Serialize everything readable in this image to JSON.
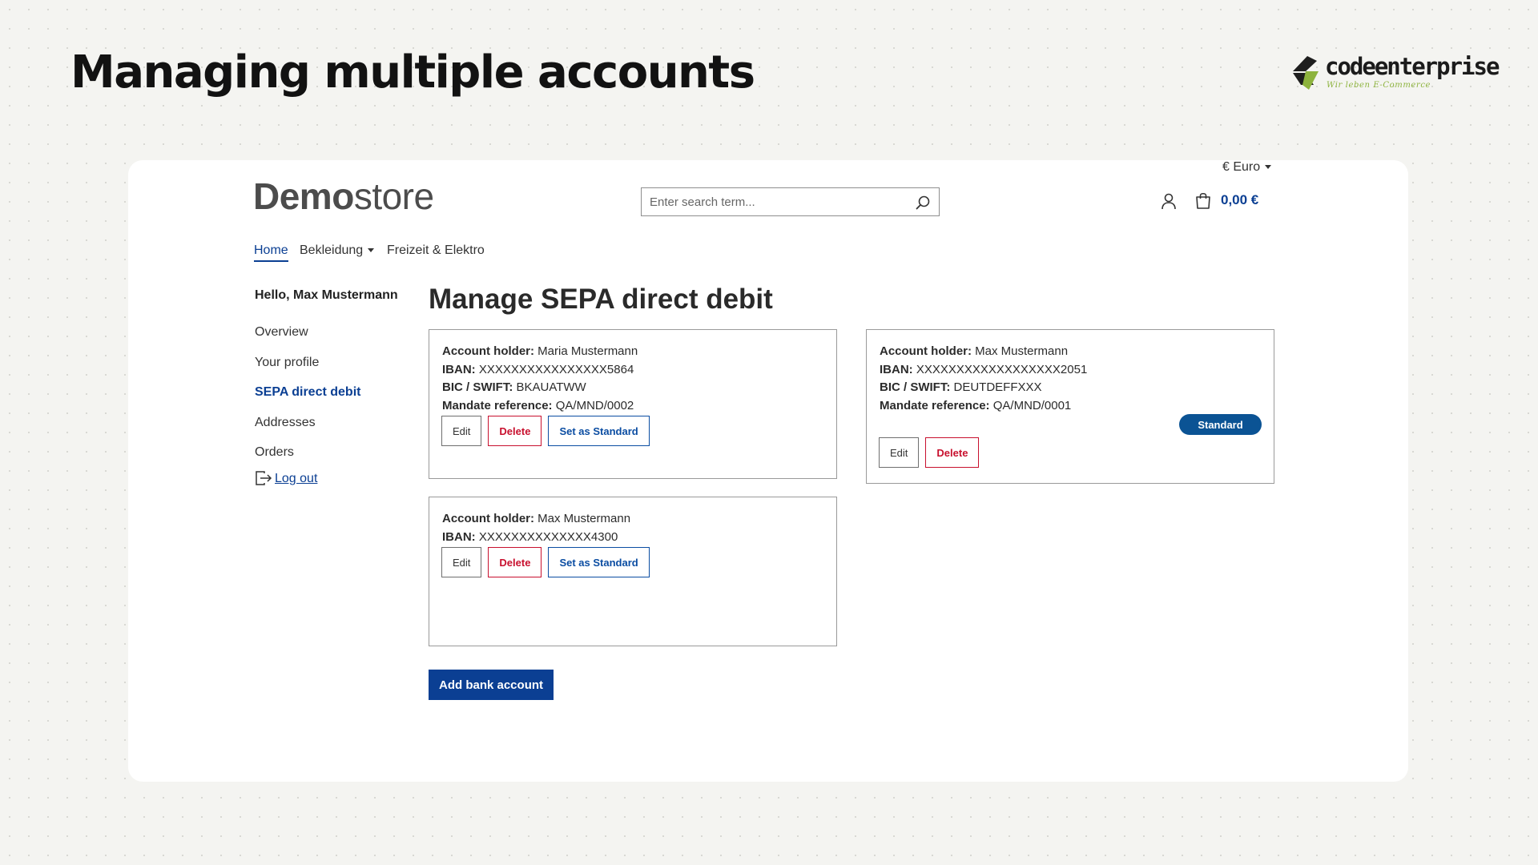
{
  "slide": {
    "title": "Managing multiple accounts",
    "logo": {
      "text": "codeenterprise",
      "tagline": "Wir leben E-Commerce"
    }
  },
  "store": {
    "brand": {
      "strong": "Demo",
      "light": "store"
    },
    "currency": "€ Euro",
    "search": {
      "placeholder": "Enter search term..."
    },
    "cart_total": "0,00 €",
    "nav": {
      "home": "Home",
      "bekleidung": "Bekleidung",
      "freizeit": "Freizeit & Elektro"
    }
  },
  "sidebar": {
    "greeting": "Hello, Max Mustermann",
    "items": [
      {
        "label": "Overview",
        "active": false
      },
      {
        "label": "Your profile",
        "active": false
      },
      {
        "label": "SEPA direct debit",
        "active": true
      },
      {
        "label": "Addresses",
        "active": false
      },
      {
        "label": "Orders",
        "active": false
      }
    ],
    "logout": "Log out"
  },
  "main": {
    "title": "Manage SEPA direct debit",
    "labels": {
      "holder": "Account holder:",
      "iban": "IBAN:",
      "bic": "BIC / SWIFT:",
      "mandate": "Mandate reference:"
    },
    "buttons": {
      "edit": "Edit",
      "delete": "Delete",
      "set_standard": "Set as Standard",
      "standard_badge": "Standard"
    },
    "accounts": [
      {
        "holder": "Maria Mustermann",
        "iban": "XXXXXXXXXXXXXXXX5864",
        "bic": "BKAUATWW",
        "mandate": "QA/MND/0002",
        "is_standard": false
      },
      {
        "holder": "Max Mustermann",
        "iban": "XXXXXXXXXXXXXXXXXX2051",
        "bic": "DEUTDEFFXXX",
        "mandate": "QA/MND/0001",
        "is_standard": true
      },
      {
        "holder": "Max Mustermann",
        "iban": "XXXXXXXXXXXXXX4300",
        "is_standard": false
      }
    ],
    "add_button": "Add bank account"
  },
  "colors": {
    "accent": "#0b3f93",
    "danger": "#c8102e",
    "badge": "#0b5394",
    "logo_green": "#8db33d"
  }
}
